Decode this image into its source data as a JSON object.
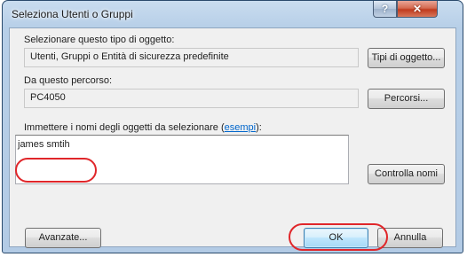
{
  "window": {
    "title": "Seleziona Utenti o Gruppi",
    "help_glyph": "?",
    "close_glyph": "✕"
  },
  "object_type": {
    "label": "Selezionare questo tipo di oggetto:",
    "value": "Utenti, Gruppi o Entità di sicurezza predefinite",
    "button": "Tipi di oggetto..."
  },
  "location": {
    "label": "Da questo percorso:",
    "value": "PC4050",
    "button": "Percorsi..."
  },
  "names": {
    "label_prefix": "Immettere i nomi degli oggetti da selezionare (",
    "label_link": "esempi",
    "label_suffix": "):",
    "value": "james smtih",
    "check_button": "Controlla nomi"
  },
  "footer": {
    "advanced_button": "Avanzate...",
    "ok_button": "OK",
    "cancel_button": "Annulla"
  },
  "colors": {
    "highlight_annotation": "#e0262a",
    "link": "#0066cc"
  }
}
